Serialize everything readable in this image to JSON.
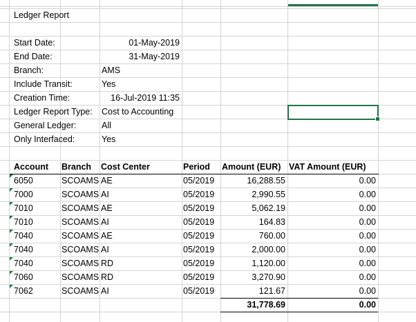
{
  "report": {
    "title": "Ledger Report",
    "params": [
      {
        "label": "Start Date:",
        "value": "01-May-2019",
        "align": "right"
      },
      {
        "label": "End Date:",
        "value": "31-May-2019",
        "align": "right"
      },
      {
        "label": "Branch:",
        "value": "AMS",
        "align": "left"
      },
      {
        "label": "Include Transit:",
        "value": "Yes",
        "align": "left"
      },
      {
        "label": "Creation Time:",
        "value": "16-Jul-2019 11:35",
        "align": "right"
      },
      {
        "label": "Ledger Report Type:",
        "value": "Cost to Accounting",
        "align": "left"
      },
      {
        "label": "General Ledger:",
        "value": "All",
        "align": "left"
      },
      {
        "label": "Only Interfaced:",
        "value": "Yes",
        "align": "left"
      }
    ]
  },
  "table": {
    "headers": [
      "Account",
      "Branch",
      "Cost Center",
      "Period",
      "Amount (EUR)",
      "VAT Amount (EUR)"
    ],
    "rows": [
      [
        "6050",
        "SCOAMS",
        "AE",
        "05/2019",
        "16,288.55",
        "0.00"
      ],
      [
        "7000",
        "SCOAMS",
        "AI",
        "05/2019",
        "2,990.55",
        "0.00"
      ],
      [
        "7010",
        "SCOAMS",
        "AE",
        "05/2019",
        "5,062.19",
        "0.00"
      ],
      [
        "7010",
        "SCOAMS",
        "AI",
        "05/2019",
        "164.83",
        "0.00"
      ],
      [
        "7040",
        "SCOAMS",
        "AE",
        "05/2019",
        "760.00",
        "0.00"
      ],
      [
        "7040",
        "SCOAMS",
        "AI",
        "05/2019",
        "2,000.00",
        "0.00"
      ],
      [
        "7040",
        "SCOAMS",
        "RD",
        "05/2019",
        "1,120.00",
        "0.00"
      ],
      [
        "7060",
        "SCOAMS",
        "RD",
        "05/2019",
        "3,270.90",
        "0.00"
      ],
      [
        "7062",
        "SCOAMS",
        "AI",
        "05/2019",
        "121.67",
        "0.00"
      ]
    ],
    "totals": {
      "amount": "31,778.69",
      "vat": "0.00"
    }
  },
  "colors": {
    "selection": "#217346",
    "gridline": "#d4d4d4",
    "number_stored_as_text_flag": "#1e7b3c"
  }
}
